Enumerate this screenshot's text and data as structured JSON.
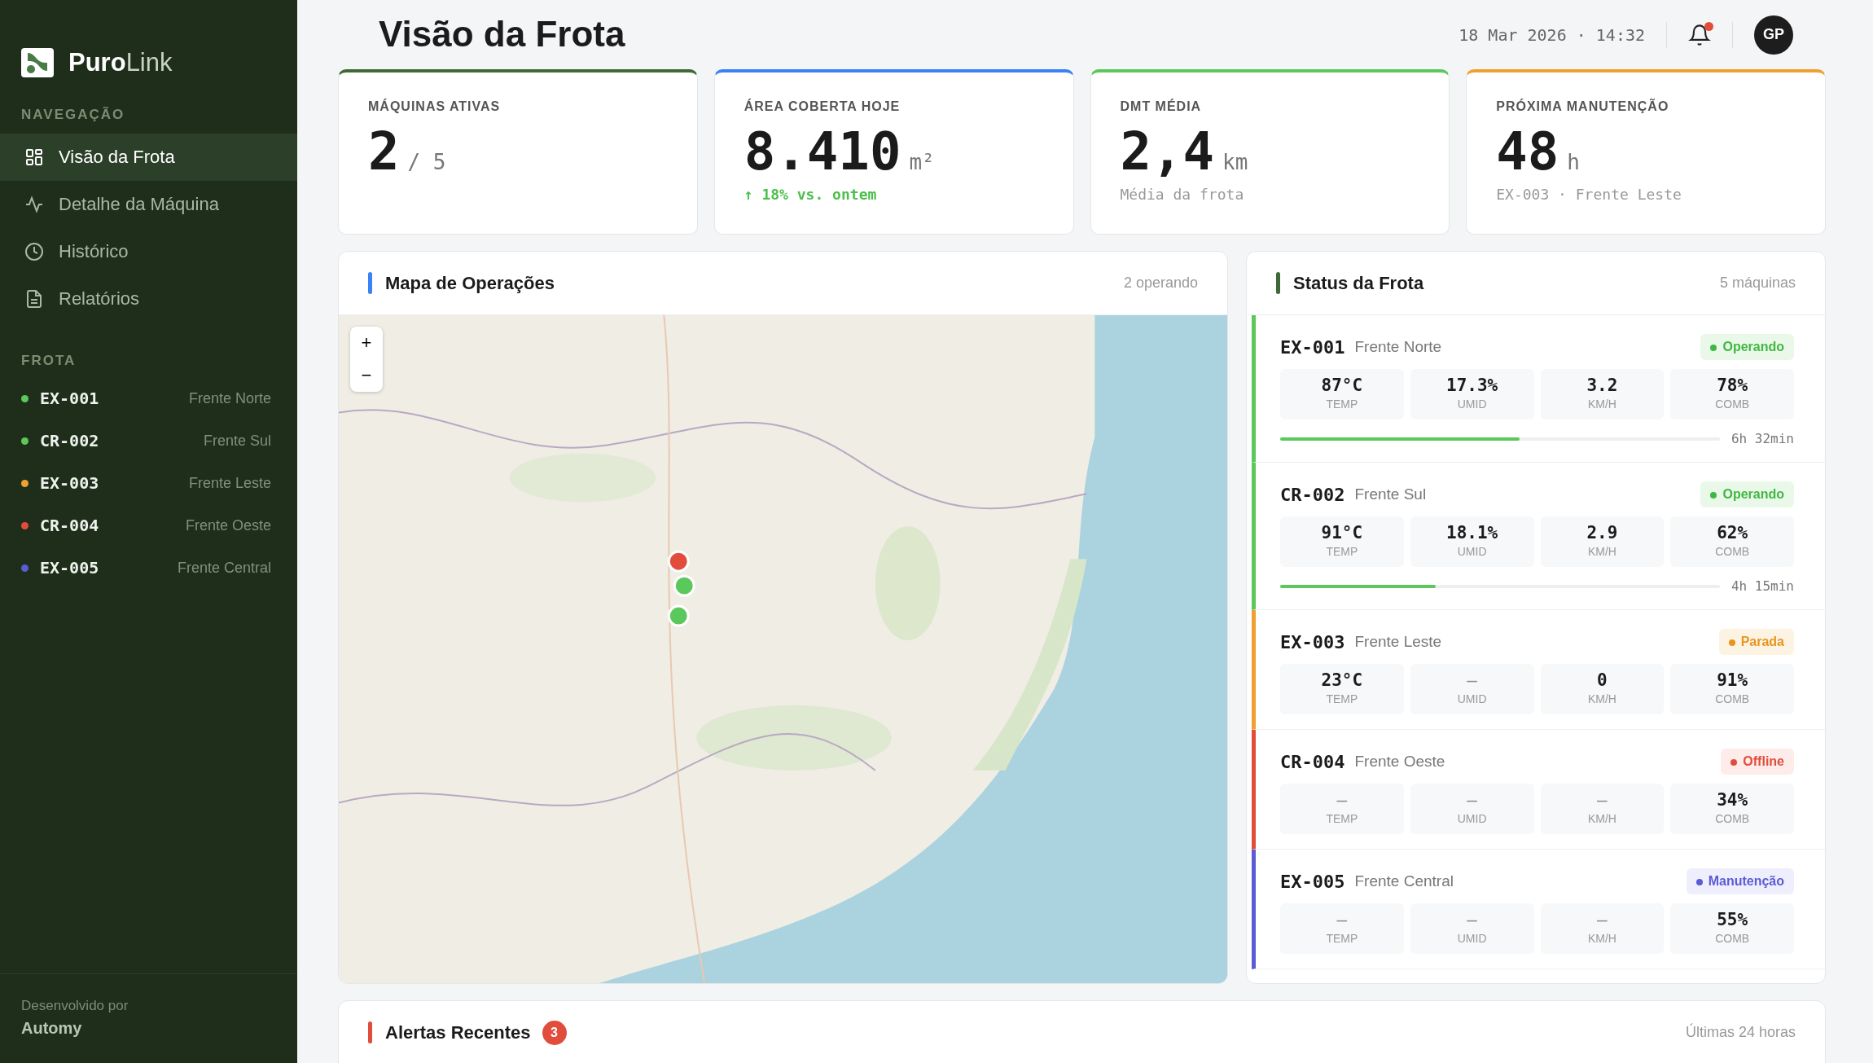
{
  "sidebar": {
    "brand": {
      "strong": "Puro",
      "light": "Link"
    },
    "nav_heading": "NAVEGAÇÃO",
    "nav_items": [
      {
        "label": "Visão da Frota",
        "selected": true
      },
      {
        "label": "Detalhe da Máquina",
        "selected": false
      },
      {
        "label": "Histórico",
        "selected": false
      },
      {
        "label": "Relatórios",
        "selected": false
      }
    ],
    "fleet_heading": "FROTA",
    "fleet": [
      {
        "code": "EX-001",
        "location": "Frente Norte",
        "color": "#5ac85a"
      },
      {
        "code": "CR-002",
        "location": "Frente Sul",
        "color": "#5ac85a"
      },
      {
        "code": "EX-003",
        "location": "Frente Leste",
        "color": "#f0a030"
      },
      {
        "code": "CR-004",
        "location": "Frente Oeste",
        "color": "#e24c3b"
      },
      {
        "code": "EX-005",
        "location": "Frente Central",
        "color": "#5b5bd6"
      }
    ],
    "footer": {
      "caption": "Desenvolvido por",
      "company": "Automy"
    }
  },
  "header": {
    "title": "Visão da Frota",
    "datetime": "18 Mar 2026 · 14:32",
    "notifications_unread": true,
    "avatar": "GP"
  },
  "kpis": [
    {
      "label": "MÁQUINAS ATIVAS",
      "value": "2",
      "unit": "/ 5",
      "color": "#3f6a37"
    },
    {
      "label": "ÁREA COBERTA HOJE",
      "value": "8.410",
      "unit": "m²",
      "note": "↑ 18% vs. ontem",
      "highlighted": true,
      "color": "#3b82f6"
    },
    {
      "label": "DMT MÉDIA",
      "value": "2,4",
      "unit": "km",
      "note": "Média da frota",
      "highlighted": false,
      "color": "#5ac85a"
    },
    {
      "label": "PRÓXIMA MANUTENÇÃO",
      "value": "48",
      "unit": "h",
      "note": "EX-003 · Frente Leste",
      "highlighted": false,
      "color": "#f0a030"
    }
  ],
  "map_panel": {
    "title": "Mapa de Operações",
    "meta": "2 operando",
    "zoom_in": "+",
    "zoom_out": "−"
  },
  "status_panel": {
    "title": "Status da Frota",
    "meta": "5 máquinas",
    "machines": [
      {
        "code": "EX-001",
        "location": "Frente Norte",
        "status": {
          "label": "Operando",
          "kind": "operating"
        },
        "metrics": [
          {
            "value": "87°C",
            "label": "TEMP",
            "missing": false
          },
          {
            "value": "17.3%",
            "label": "UMID",
            "missing": false
          },
          {
            "value": "3.2",
            "label": "KM/H",
            "missing": false
          },
          {
            "value": "78%",
            "label": "COMB",
            "missing": false
          }
        ],
        "runtime": {
          "level": 0.545,
          "text": "6h 32min"
        }
      },
      {
        "code": "CR-002",
        "location": "Frente Sul",
        "status": {
          "label": "Operando",
          "kind": "operating"
        },
        "metrics": [
          {
            "value": "91°C",
            "label": "TEMP",
            "missing": false
          },
          {
            "value": "18.1%",
            "label": "UMID",
            "missing": false
          },
          {
            "value": "2.9",
            "label": "KM/H",
            "missing": false
          },
          {
            "value": "62%",
            "label": "COMB",
            "missing": false
          }
        ],
        "runtime": {
          "level": 0.354,
          "text": "4h 15min"
        }
      },
      {
        "code": "EX-003",
        "location": "Frente Leste",
        "status": {
          "label": "Parada",
          "kind": "stopped"
        },
        "metrics": [
          {
            "value": "23°C",
            "label": "TEMP",
            "missing": false
          },
          {
            "value": "—",
            "label": "UMID",
            "missing": true
          },
          {
            "value": "0",
            "label": "KM/H",
            "missing": false
          },
          {
            "value": "91%",
            "label": "COMB",
            "missing": false
          }
        ]
      },
      {
        "code": "CR-004",
        "location": "Frente Oeste",
        "status": {
          "label": "Offline",
          "kind": "offline"
        },
        "metrics": [
          {
            "value": "—",
            "label": "TEMP",
            "missing": true
          },
          {
            "value": "—",
            "label": "UMID",
            "missing": true
          },
          {
            "value": "—",
            "label": "KM/H",
            "missing": true
          },
          {
            "value": "34%",
            "label": "COMB",
            "missing": false
          }
        ]
      },
      {
        "code": "EX-005",
        "location": "Frente Central",
        "status": {
          "label": "Manutenção",
          "kind": "maintenance"
        },
        "metrics": [
          {
            "value": "—",
            "label": "TEMP",
            "missing": true
          },
          {
            "value": "—",
            "label": "UMID",
            "missing": true
          },
          {
            "value": "—",
            "label": "KM/H",
            "missing": true
          },
          {
            "value": "55%",
            "label": "COMB",
            "missing": false
          }
        ]
      }
    ]
  },
  "alerts_panel": {
    "title": "Alertas Recentes",
    "count": "3",
    "meta": "Últimas 24 horas"
  }
}
